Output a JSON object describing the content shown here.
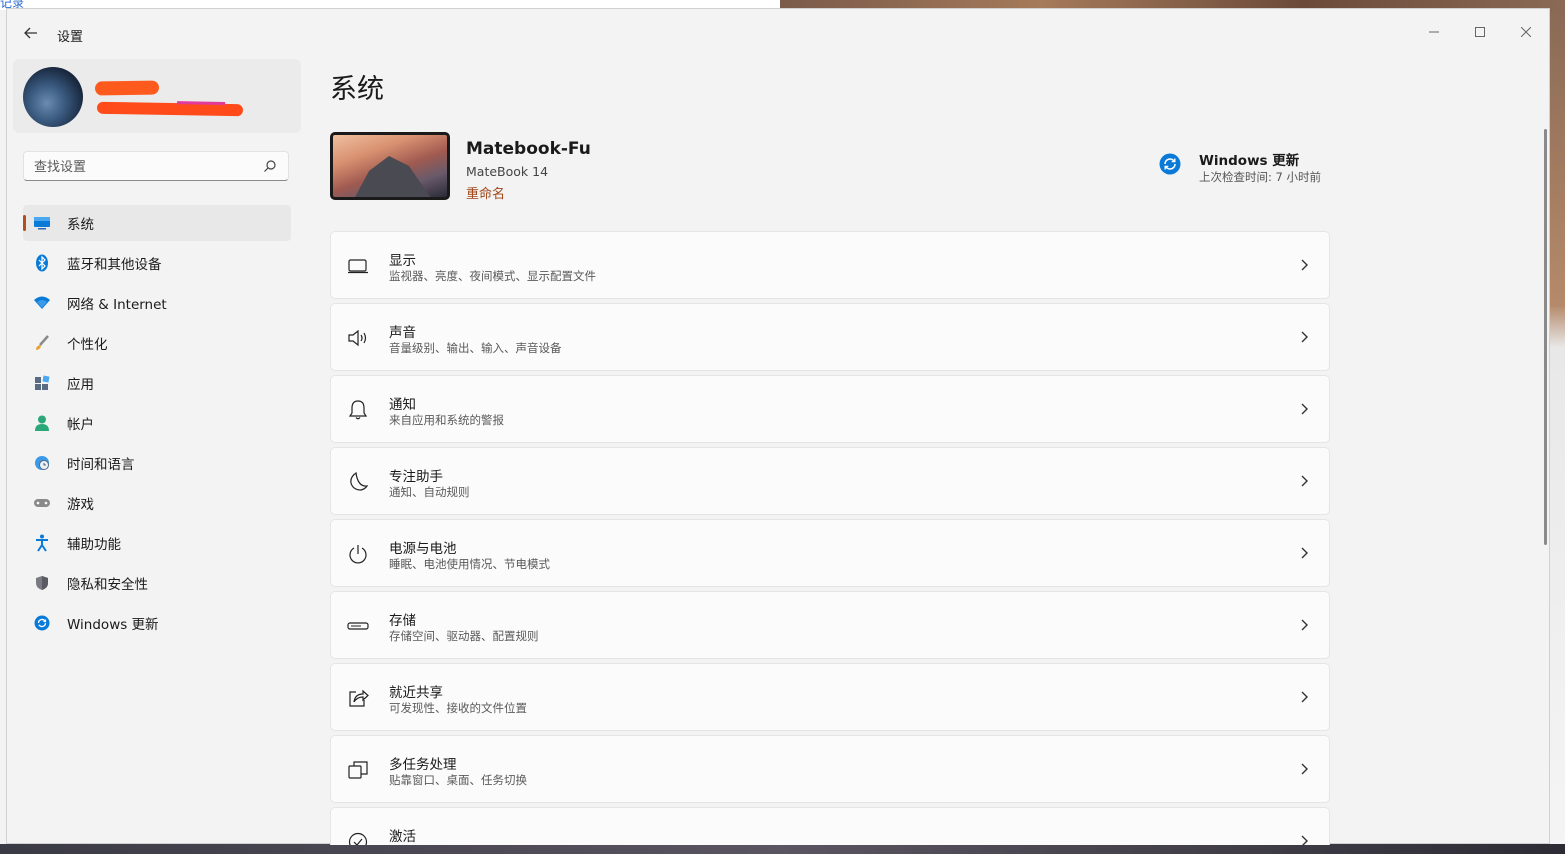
{
  "background": {
    "corner_text": "记录"
  },
  "window": {
    "title": "设置",
    "controls": {
      "minimize": "minimize-icon",
      "maximize": "maximize-icon",
      "close": "close-icon"
    }
  },
  "sidebar": {
    "search": {
      "placeholder": "查找设置"
    },
    "items": [
      {
        "label": "系统",
        "icon": "display-icon",
        "active": true
      },
      {
        "label": "蓝牙和其他设备",
        "icon": "bluetooth-icon"
      },
      {
        "label": "网络 & Internet",
        "icon": "wifi-icon"
      },
      {
        "label": "个性化",
        "icon": "brush-icon"
      },
      {
        "label": "应用",
        "icon": "apps-icon"
      },
      {
        "label": "帐户",
        "icon": "account-icon"
      },
      {
        "label": "时间和语言",
        "icon": "globe-clock-icon"
      },
      {
        "label": "游戏",
        "icon": "gamepad-icon"
      },
      {
        "label": "辅助功能",
        "icon": "accessibility-icon"
      },
      {
        "label": "隐私和安全性",
        "icon": "shield-icon"
      },
      {
        "label": "Windows 更新",
        "icon": "sync-icon"
      }
    ]
  },
  "main": {
    "title": "系统",
    "device": {
      "name": "Matebook-Fu",
      "model": "MateBook 14",
      "rename": "重命名"
    },
    "windows_update": {
      "title": "Windows 更新",
      "subtitle": "上次检查时间: 7 小时前"
    },
    "cards": [
      {
        "title": "显示",
        "subtitle": "监视器、亮度、夜间模式、显示配置文件",
        "icon": "monitor-icon"
      },
      {
        "title": "声音",
        "subtitle": "音量级别、输出、输入、声音设备",
        "icon": "speaker-icon"
      },
      {
        "title": "通知",
        "subtitle": "来自应用和系统的警报",
        "icon": "bell-icon"
      },
      {
        "title": "专注助手",
        "subtitle": "通知、自动规则",
        "icon": "moon-icon"
      },
      {
        "title": "电源与电池",
        "subtitle": "睡眠、电池使用情况、节电模式",
        "icon": "power-icon"
      },
      {
        "title": "存储",
        "subtitle": "存储空间、驱动器、配置规则",
        "icon": "storage-icon"
      },
      {
        "title": "就近共享",
        "subtitle": "可发现性、接收的文件位置",
        "icon": "share-icon"
      },
      {
        "title": "多任务处理",
        "subtitle": "贴靠窗口、桌面、任务切换",
        "icon": "multitask-icon"
      },
      {
        "title": "激活",
        "subtitle": "",
        "icon": "check-circle-icon"
      }
    ]
  },
  "colors": {
    "accent": "#b3501a",
    "link": "#a0461a",
    "update_blue": "#0a7ad8"
  }
}
